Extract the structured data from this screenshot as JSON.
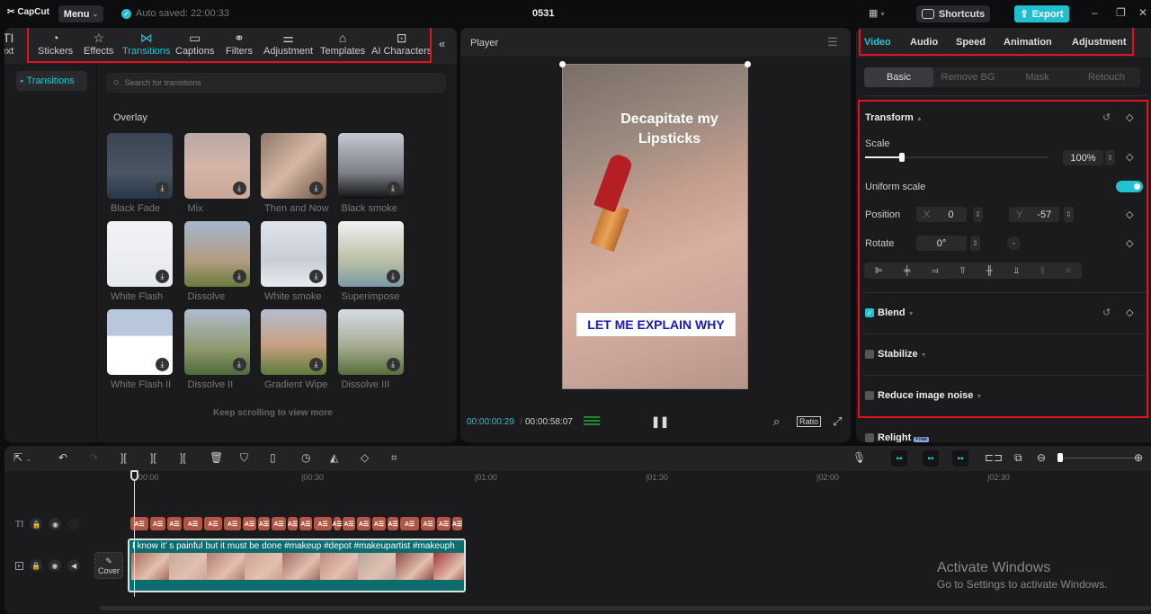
{
  "app": {
    "logo": "CapCut",
    "menu_label": "Menu",
    "autosave": "Auto saved: 22:00:33",
    "project_title": "0531",
    "shortcuts_label": "Shortcuts",
    "export_label": "Export",
    "accent_color": "#21c2d1"
  },
  "toolbar": {
    "partial_tool": "Text",
    "tools": [
      {
        "label": "Stickers",
        "icon": "sticker-icon"
      },
      {
        "label": "Effects",
        "icon": "effects-star-icon"
      },
      {
        "label": "Transitions",
        "icon": "transitions-bowtie-icon",
        "active": true
      },
      {
        "label": "Captions",
        "icon": "captions-icon"
      },
      {
        "label": "Filters",
        "icon": "filters-circles-icon"
      },
      {
        "label": "Adjustment",
        "icon": "adjustment-sliders-icon"
      },
      {
        "label": "Templates",
        "icon": "templates-icon"
      },
      {
        "label": "AI Characters",
        "icon": "ai-characters-icon"
      }
    ]
  },
  "transitions_panel": {
    "category": "Transitions",
    "search_placeholder": "Search for transitions",
    "section_title": "Overlay",
    "items": [
      {
        "label": "Black Fade"
      },
      {
        "label": "Mix"
      },
      {
        "label": "Then and Now"
      },
      {
        "label": "Black smoke"
      },
      {
        "label": "White Flash"
      },
      {
        "label": "Dissolve"
      },
      {
        "label": "White smoke"
      },
      {
        "label": "Superimpose"
      },
      {
        "label": "White Flash II"
      },
      {
        "label": "Dissolve II"
      },
      {
        "label": "Gradient Wipe"
      },
      {
        "label": "Dissolve III"
      }
    ],
    "footer": "Keep scrolling to view more"
  },
  "player": {
    "title": "Player",
    "overlay_title": "Decapitate my Lipsticks",
    "overlay_caption": "LET ME EXPLAIN WHY",
    "current_time": "00:00:00:29",
    "total_time": "00:00:58:07",
    "ratio_label": "Ratio"
  },
  "inspector": {
    "tabs": [
      {
        "label": "Video",
        "active": true
      },
      {
        "label": "Audio"
      },
      {
        "label": "Speed"
      },
      {
        "label": "Animation"
      },
      {
        "label": "Adjustment"
      }
    ],
    "subtabs": [
      {
        "label": "Basic",
        "active": true
      },
      {
        "label": "Remove BG"
      },
      {
        "label": "Mask"
      },
      {
        "label": "Retouch"
      }
    ],
    "transform": {
      "title": "Transform",
      "scale_label": "Scale",
      "scale_value": "100%",
      "scale_slider_fraction": 0.2,
      "uniform_scale_label": "Uniform scale",
      "uniform_scale_on": true,
      "position_label": "Position",
      "x_label": "X",
      "x_value": "0",
      "y_label": "Y",
      "y_value": "-57",
      "rotate_label": "Rotate",
      "rotate_value": "0°"
    },
    "blend": {
      "label": "Blend",
      "checked": true
    },
    "stabilize": {
      "label": "Stabilize",
      "checked": false
    },
    "reduce_noise": {
      "label": "Reduce image noise",
      "checked": false
    },
    "relight": {
      "label": "Relight",
      "badge": "Free",
      "checked": false
    }
  },
  "timeline": {
    "ruler": [
      "00:00",
      "|00:30",
      "|01:00",
      "|01:30",
      "|02:00",
      "|02:30"
    ],
    "video_clip_caption": "I know it’ s painful but it must be done #makeup #depot #makeupartist #makeuph",
    "cover_label": "Cover",
    "text_clip_glyph": "A☰"
  },
  "watermark": {
    "line1": "Activate Windows",
    "line2": "Go to Settings to activate Windows."
  }
}
